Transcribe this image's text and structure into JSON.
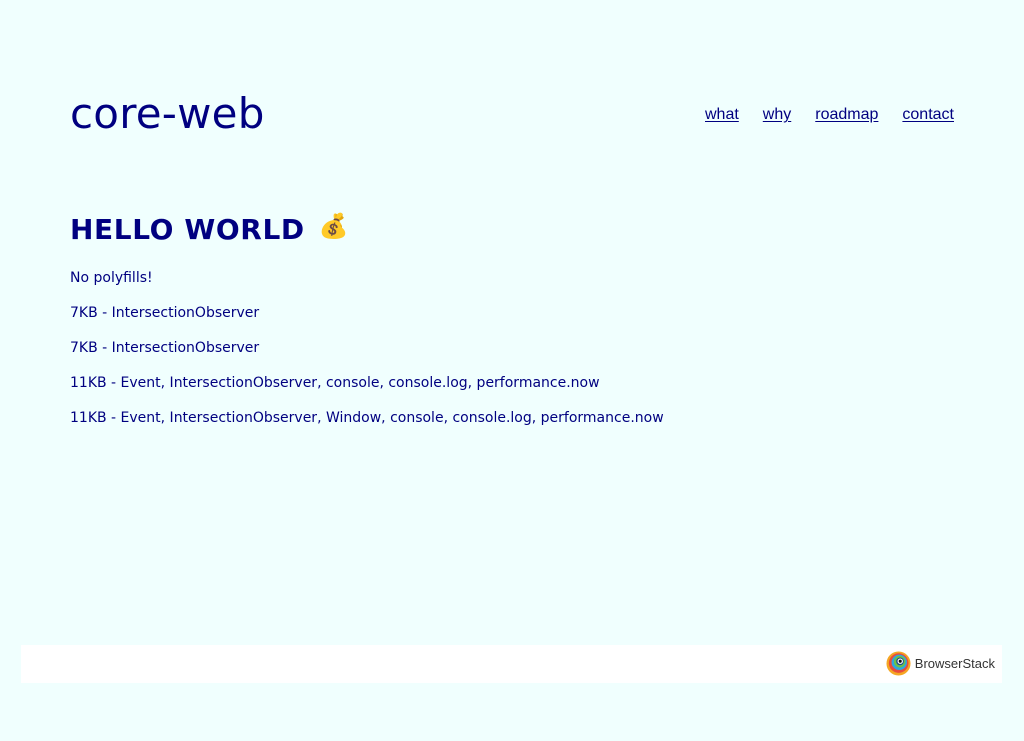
{
  "header": {
    "brand": "core-web",
    "nav": [
      "what",
      "why",
      "roadmap",
      "contact"
    ]
  },
  "main": {
    "title": "HELLO WORLD",
    "emoji": "💰",
    "items": [
      "No polyfills!",
      "7KB - IntersectionObserver",
      "7KB - IntersectionObserver",
      "11KB - Event, IntersectionObserver, console, console.log, performance.now",
      "11KB - Event, IntersectionObserver, Window, console, console.log, performance.now"
    ]
  },
  "footer": {
    "sponsor": "BrowserStack",
    "logo_icon": "browserstack-logo-icon"
  },
  "colors": {
    "background": "#f0fffe",
    "text": "#000080",
    "footer_background": "#ffffff"
  }
}
